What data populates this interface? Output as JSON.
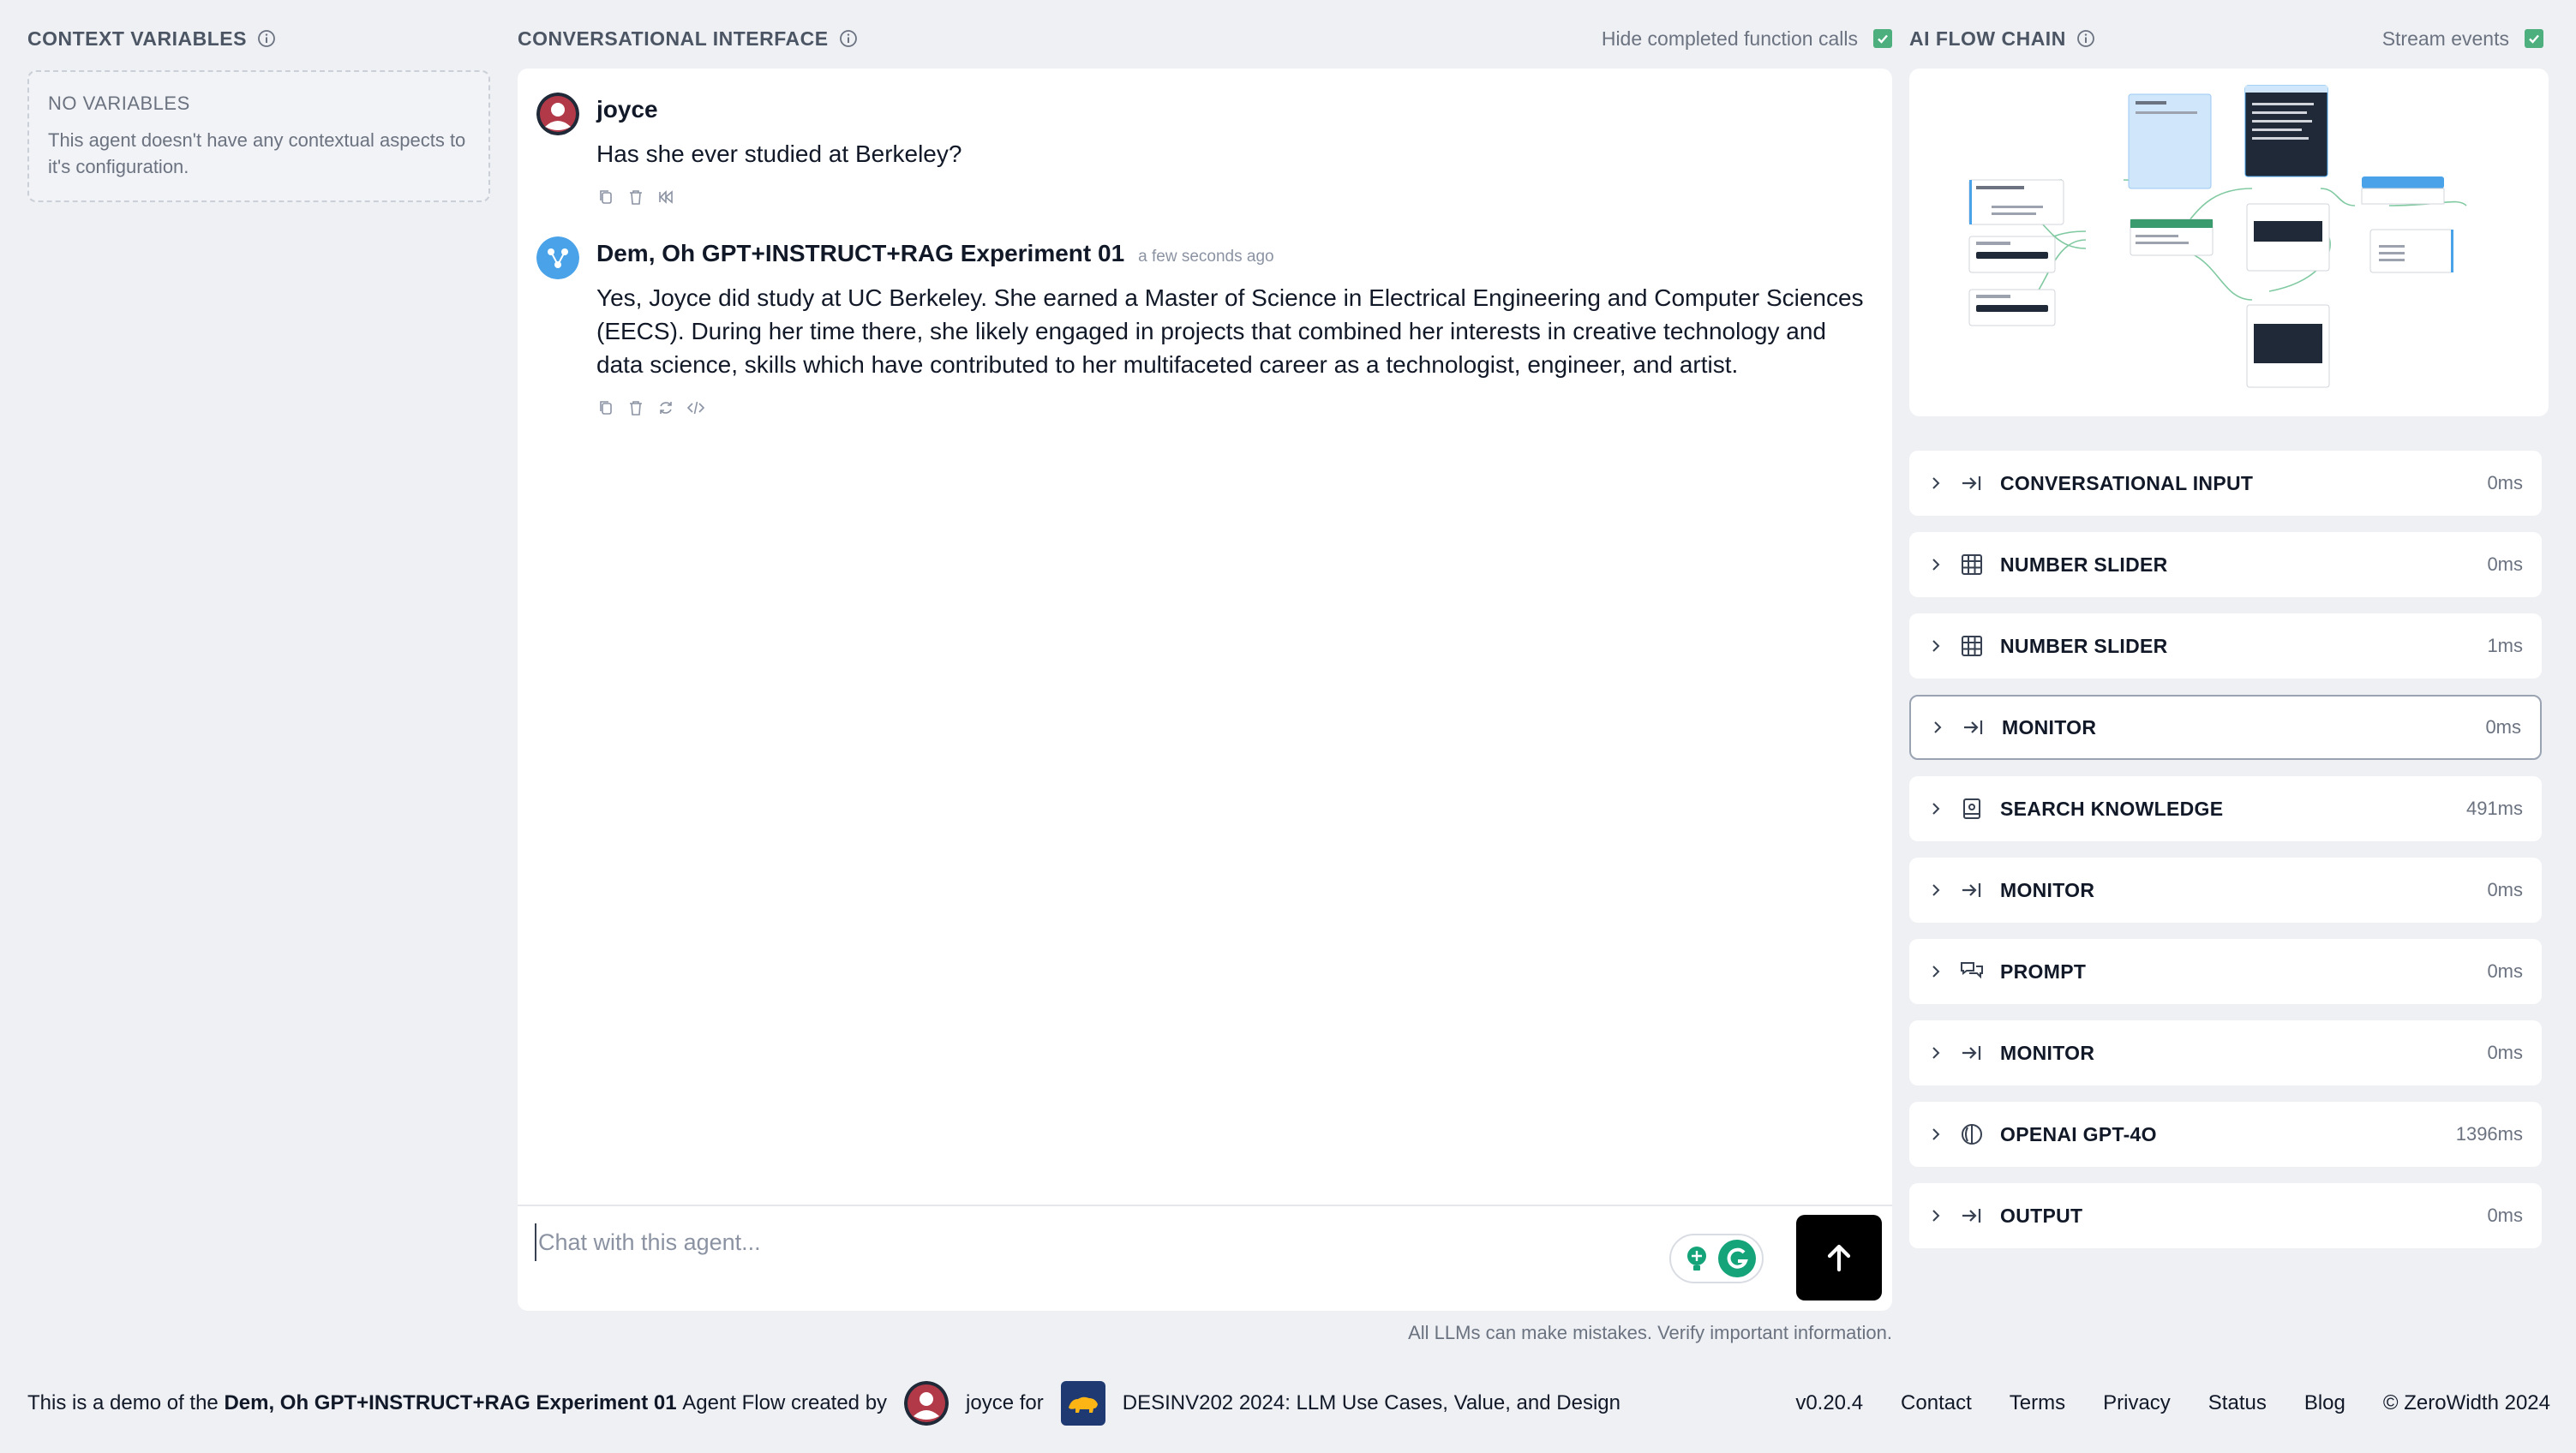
{
  "left": {
    "title": "CONTEXT VARIABLES",
    "empty_title": "NO VARIABLES",
    "empty_desc": "This agent doesn't have any contextual aspects to it's configuration."
  },
  "middle": {
    "title": "CONVERSATIONAL INTERFACE",
    "hide_toggle_label": "Hide completed function calls",
    "hide_toggle_checked": true,
    "messages": [
      {
        "author": "joyce",
        "timestamp": "",
        "text": "Has she ever studied at Berkeley?",
        "avatar_color": "#b23a48"
      },
      {
        "author": "Dem, Oh GPT+INSTRUCT+RAG Experiment 01",
        "timestamp": "a few seconds ago",
        "text": "Yes, Joyce did study at UC Berkeley. She earned a Master of Science in Electrical Engineering and Computer Sciences (EECS). During her time there, she likely engaged in projects that combined her interests in creative technology and data science, skills which have contributed to her multifaceted career as a technologist, engineer, and artist.",
        "avatar_color": "#4aa3e8"
      }
    ],
    "input_placeholder": "Chat with this agent...",
    "disclaimer": "All LLMs can make mistakes. Verify important information."
  },
  "right": {
    "title": "AI FLOW CHAIN",
    "stream_label": "Stream events",
    "stream_checked": true,
    "steps": [
      {
        "label": "CONVERSATIONAL INPUT",
        "time": "0ms",
        "icon": "arrow-to-line-icon"
      },
      {
        "label": "NUMBER SLIDER",
        "time": "0ms",
        "icon": "grid-icon"
      },
      {
        "label": "NUMBER SLIDER",
        "time": "1ms",
        "icon": "grid-icon"
      },
      {
        "label": "MONITOR",
        "time": "0ms",
        "icon": "arrow-to-line-icon"
      },
      {
        "label": "SEARCH KNOWLEDGE",
        "time": "491ms",
        "icon": "book-icon"
      },
      {
        "label": "MONITOR",
        "time": "0ms",
        "icon": "arrow-to-line-icon"
      },
      {
        "label": "PROMPT",
        "time": "0ms",
        "icon": "chat-bubbles-icon"
      },
      {
        "label": "MONITOR",
        "time": "0ms",
        "icon": "arrow-to-line-icon"
      },
      {
        "label": "OPENAI GPT-4O",
        "time": "1396ms",
        "icon": "openai-icon"
      },
      {
        "label": "OUTPUT",
        "time": "0ms",
        "icon": "arrow-to-line-icon"
      }
    ],
    "active_index": 3
  },
  "footer": {
    "prefix": "This is a demo of the",
    "agent_name": "Dem, Oh GPT+INSTRUCT+RAG Experiment 01",
    "middle": "Agent Flow created by",
    "creator": "joyce for",
    "course": "DESINV202 2024: LLM Use Cases, Value, and Design",
    "version": "v0.20.4",
    "links": [
      "Contact",
      "Terms",
      "Privacy",
      "Status",
      "Blog"
    ],
    "copyright": "© ZeroWidth 2024"
  },
  "colors": {
    "background": "#eef0f4",
    "accent_check": "#4caf7d",
    "user_avatar": "#b23a48",
    "agent_avatar": "#4aa3e8"
  }
}
